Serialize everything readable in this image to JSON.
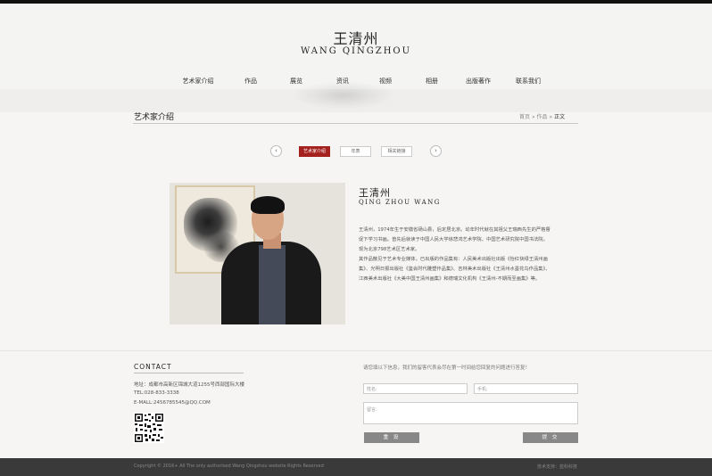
{
  "header": {
    "title_cn": "王清州",
    "title_en": "WANG QINGZHOU"
  },
  "nav": [
    "艺术家介绍",
    "作品",
    "展览",
    "资讯",
    "视频",
    "相册",
    "出版著作",
    "联系我们"
  ],
  "section": {
    "title": "艺术家介绍",
    "breadcrumb": [
      "首页",
      "作品",
      "正文"
    ],
    "breadcrumb_sep": "»"
  },
  "tabs": [
    {
      "label": "艺术家介绍",
      "active": true
    },
    {
      "label": "年表",
      "active": false
    },
    {
      "label": "相关链接",
      "active": false
    }
  ],
  "pager": {
    "prev": "‹",
    "next": "›"
  },
  "artist": {
    "name_cn": "王清州",
    "name_en": "QING ZHOU WANG",
    "bio": [
      "王清州，1974年生于安徽省砀山县，后定居北京。幼年时代就在其祖父王瑞西先生的严格督促下学习书画。曾先后就读于中国人民大学徐悲鸿艺术学院、中国艺术研究院中国书法院。现为北京798艺术区艺术家。",
      "其作品散见于艺术专业媒体，已出版的作品集有：人民美术出版社出版《怡红快绿王清州画集》、光明日报出版社《鉴会时代雕塑作品集》、吉林美术出版社《王清州水墨花鸟作品集》、江西美术出版社《大美中国王清州画集》和德瑞文化机构《王清州-不期而至画集》等。"
    ]
  },
  "contact": {
    "title": "CONTACT",
    "address": "地址：成都市高新区锦城大道1255号西部国际大楼",
    "tel": "TEL:028-833-3338",
    "email": "E-MALL:2456785545@QQ.COM"
  },
  "form": {
    "prompt": "请您填以下信息，我们的留客代表会尽在第一时间给您回复的问题进行答复！",
    "name_placeholder": "姓名:",
    "phone_placeholder": "手机:",
    "message_placeholder": "留言:",
    "reset_label": "重 设",
    "submit_label": "提 交"
  },
  "footer": {
    "copyright": "Copyright © 2016+ All The only authorised Wang Qingzhou website Rights Reserved",
    "support": "技术支持：蓝科科技"
  },
  "colors": {
    "accent": "#a5211d",
    "footer_bg": "#3a3a3a",
    "button_bg": "#888888"
  }
}
